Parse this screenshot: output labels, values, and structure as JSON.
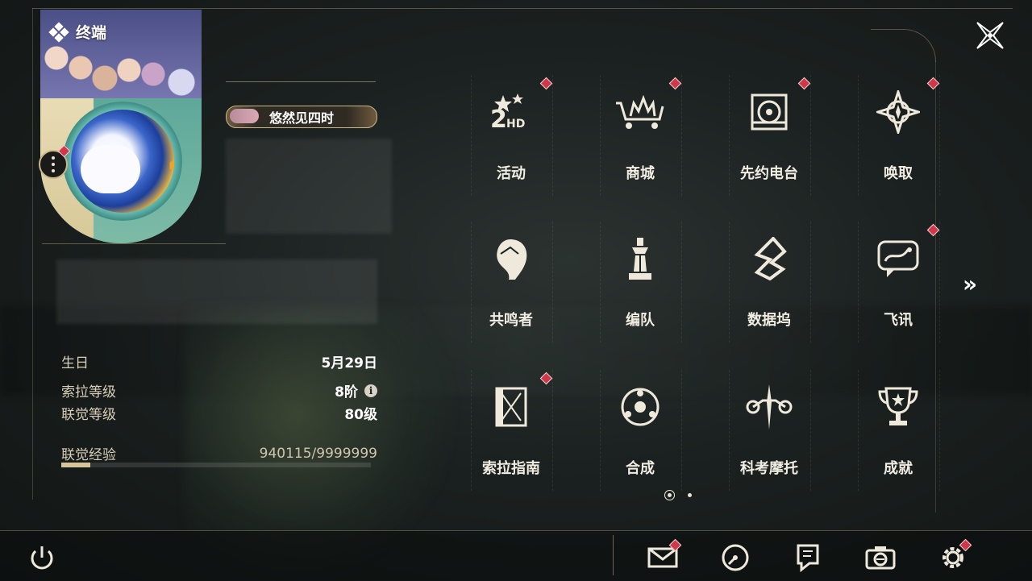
{
  "terminal": {
    "title": "终端"
  },
  "profile": {
    "name": "悠然见四时",
    "stats": [
      {
        "label": "生日",
        "value": "5月29日"
      },
      {
        "label": "索拉等级",
        "value": "8阶"
      },
      {
        "label": "联觉等级",
        "value": "80级"
      }
    ],
    "exp": {
      "label": "联觉经验",
      "value": "940115/9999999",
      "fraction": 0.094
    }
  },
  "menu": {
    "items": [
      {
        "label": "活动",
        "icon": "event-2hd-icon",
        "badge": true
      },
      {
        "label": "商城",
        "icon": "shop-cart-icon",
        "badge": true
      },
      {
        "label": "先约电台",
        "icon": "radio-icon",
        "badge": true
      },
      {
        "label": "唤取",
        "icon": "summon-compass-icon",
        "badge": true
      },
      {
        "label": "共鸣者",
        "icon": "resonator-head-icon",
        "badge": false
      },
      {
        "label": "编队",
        "icon": "chess-team-icon",
        "badge": false
      },
      {
        "label": "数据坞",
        "icon": "data-dock-icon",
        "badge": false
      },
      {
        "label": "飞讯",
        "icon": "message-bubble-icon",
        "badge": true
      },
      {
        "label": "索拉指南",
        "icon": "guide-book-icon",
        "badge": true
      },
      {
        "label": "合成",
        "icon": "synthesis-icon",
        "badge": false
      },
      {
        "label": "科考摩托",
        "icon": "motorbike-icon",
        "badge": false
      },
      {
        "label": "成就",
        "icon": "trophy-icon",
        "badge": false
      }
    ],
    "page": {
      "current": 1,
      "total": 2
    }
  },
  "bottom": {
    "icons": [
      "mail-icon",
      "clock-icon",
      "notice-icon",
      "camera-icon",
      "settings-gear-icon",
      "power-icon"
    ]
  },
  "colors": {
    "accent": "#c9b78a",
    "badge": "#d0384a",
    "text": "#f1ede2"
  }
}
